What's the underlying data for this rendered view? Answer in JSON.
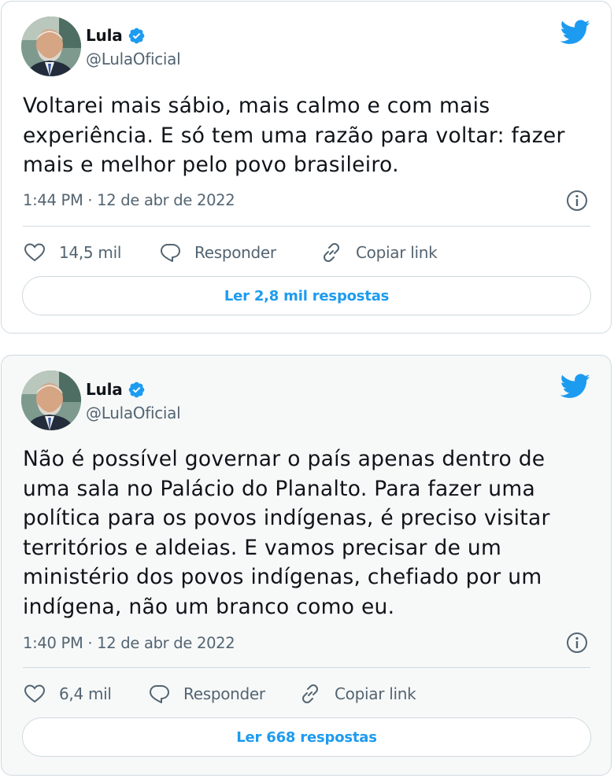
{
  "tweets": [
    {
      "author": {
        "name": "Lula",
        "handle": "@LulaOficial",
        "verified": true,
        "avatar": "lula-avatar"
      },
      "text": "Voltarei mais sábio, mais calmo e com mais\nexperiência. E só tem uma razão para voltar: fazer\nmais e melhor pelo povo brasileiro.",
      "timestamp": "1:44 PM · 12 de abr de 2022",
      "likes": "14,5 mil",
      "reply_label": "Responder",
      "copy_link_label": "Copiar link",
      "read_replies_label": "Ler 2,8 mil respostas",
      "icons": {
        "brand": "twitter-bird-icon",
        "info": "info-icon",
        "like": "heart-icon",
        "reply": "speech-bubble-icon",
        "copy": "link-icon"
      }
    },
    {
      "author": {
        "name": "Lula",
        "handle": "@LulaOficial",
        "verified": true,
        "avatar": "lula-avatar"
      },
      "text": "Não é possível governar o país apenas dentro de\numa sala no Palácio do Planalto. Para fazer uma\npolítica para os povos indígenas, é preciso visitar\nterritórios e aldeias. E vamos precisar de um\nministério dos povos indígenas, chefiado por um\nindígena, não um branco como eu.",
      "timestamp": "1:40 PM · 12 de abr de 2022",
      "likes": "6,4 mil",
      "reply_label": "Responder",
      "copy_link_label": "Copiar link",
      "read_replies_label": "Ler 668 respostas",
      "icons": {
        "brand": "twitter-bird-icon",
        "info": "info-icon",
        "like": "heart-icon",
        "reply": "speech-bubble-icon",
        "copy": "link-icon"
      }
    }
  ],
  "colors": {
    "accent": "#1d9bf0",
    "text": "#0f1419",
    "secondary": "#536471",
    "border": "#cfd9de"
  }
}
